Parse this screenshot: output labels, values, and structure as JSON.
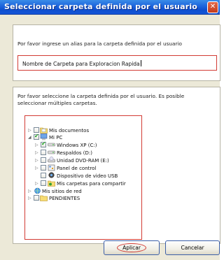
{
  "window": {
    "title": "Seleccionar carpeta definida por el usuario"
  },
  "alias_section": {
    "label": "Por favor ingrese un alias para la carpeta definida por el usuario",
    "value": "Nombre de Carpeta para Exploracion Rapida"
  },
  "folders_section": {
    "label_line1": "Por favor seleccione la carpeta definida por el usuario. Es posible",
    "label_line2": "seleccionar múltiples carpetas."
  },
  "tree": [
    {
      "label": "Mis documentos",
      "expander": "▷",
      "checked": false,
      "icon": "folder-documents-icon"
    },
    {
      "label": "Mi PC",
      "expander": "◢",
      "checked": true,
      "icon": "computer-icon"
    },
    {
      "label": "Windows XP (C:)",
      "expander": "▷",
      "checked": true,
      "icon": "drive-icon"
    },
    {
      "label": "Respaldos (D:)",
      "expander": "▷",
      "checked": false,
      "icon": "drive-icon"
    },
    {
      "label": "Unidad DVD-RAM (E:)",
      "expander": "▷",
      "checked": false,
      "icon": "dvd-drive-icon"
    },
    {
      "label": "Panel de control",
      "expander": "▷",
      "checked": false,
      "icon": "control-panel-icon"
    },
    {
      "label": "Dispositivo de video USB",
      "expander": "",
      "checked": false,
      "icon": "webcam-icon"
    },
    {
      "label": "Mis carpetas para compartir",
      "expander": "▷",
      "checked": false,
      "icon": "shared-folder-icon"
    },
    {
      "label": "Mis sitios de red",
      "expander": "▷",
      "checked": false,
      "icon": "network-places-icon"
    },
    {
      "label": "PENDIENTES",
      "expander": "▷",
      "checked": false,
      "icon": "folder-icon"
    }
  ],
  "buttons": {
    "ok": "Aplicar",
    "cancel": "Cancelar"
  }
}
